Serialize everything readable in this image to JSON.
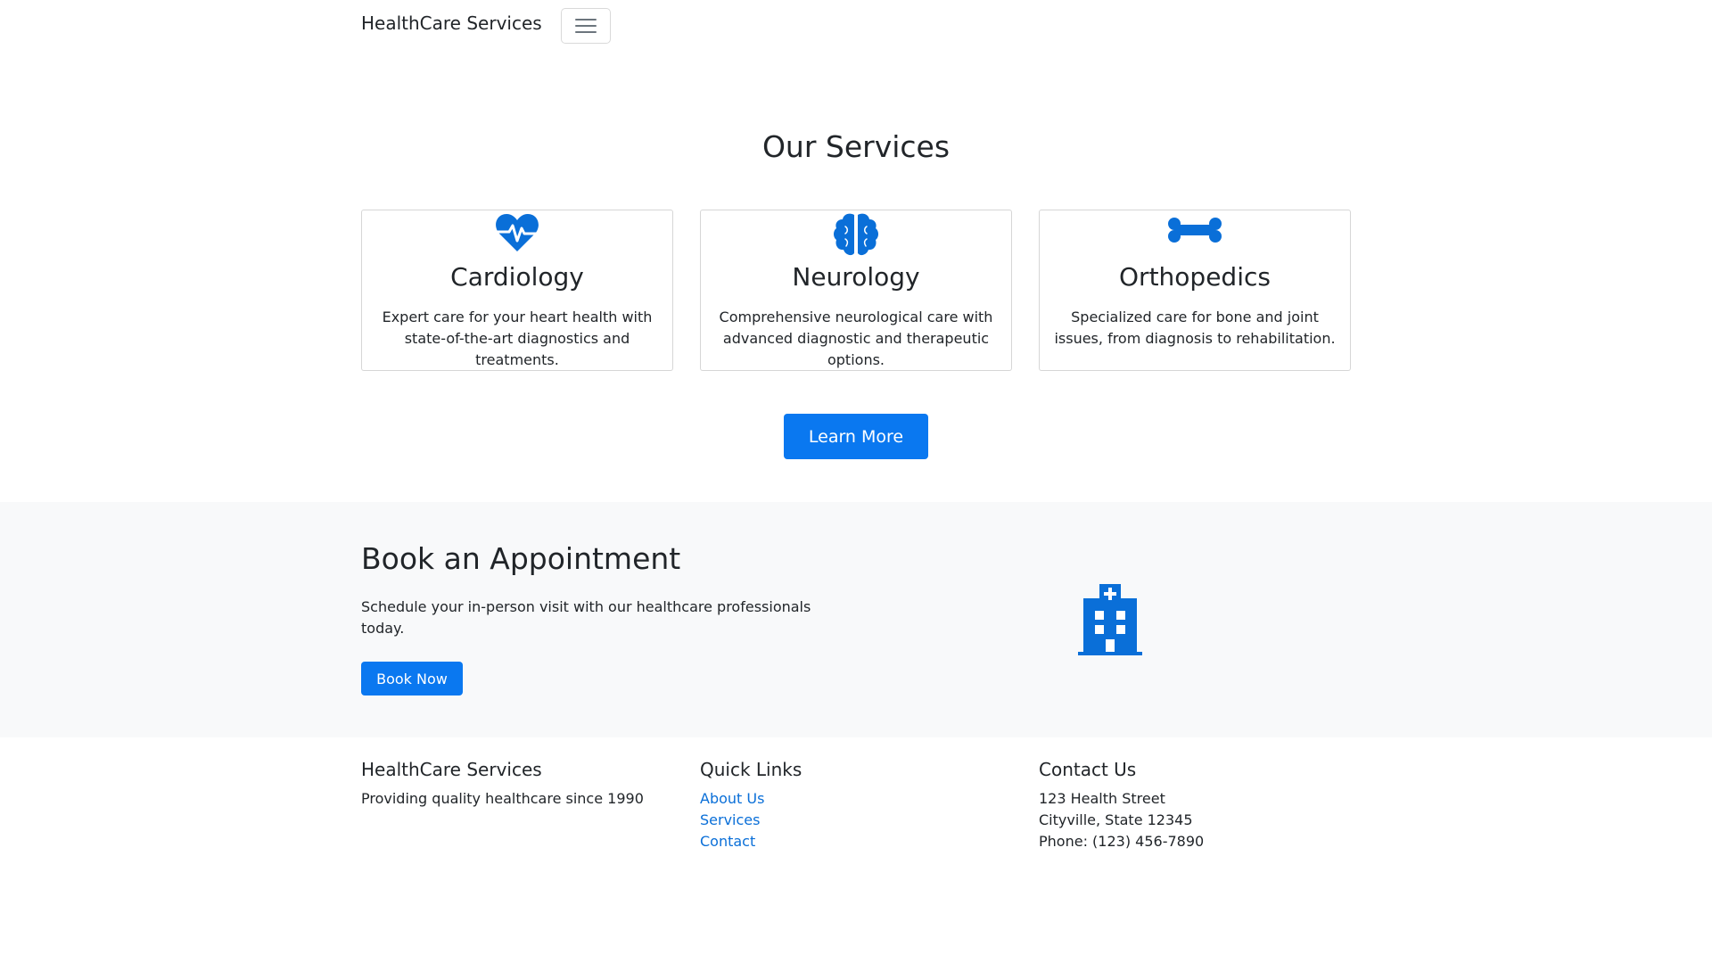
{
  "navbar": {
    "brand": "HealthCare Services",
    "toggler_icon": "hamburger-icon"
  },
  "services": {
    "title": "Our Services",
    "cards": [
      {
        "icon": "heartbeat-icon",
        "title": "Cardiology",
        "text": "Expert care for your heart health with state-of-the-art diagnostics and treatments."
      },
      {
        "icon": "brain-icon",
        "title": "Neurology",
        "text": "Comprehensive neurological care with advanced diagnostic and therapeutic options."
      },
      {
        "icon": "bone-icon",
        "title": "Orthopedics",
        "text": "Specialized care for bone and joint issues, from diagnosis to rehabilitation."
      }
    ],
    "learn_more_label": "Learn More"
  },
  "appointment": {
    "title": "Book an Appointment",
    "text": "Schedule your in-person visit with our healthcare professionals today.",
    "button_label": "Book Now",
    "icon": "hospital-icon"
  },
  "footer": {
    "about": {
      "title": "HealthCare Services",
      "text": "Providing quality healthcare since 1990"
    },
    "quick_links": {
      "title": "Quick Links",
      "links": [
        "About Us",
        "Services",
        "Contact"
      ]
    },
    "contact": {
      "title": "Contact Us",
      "lines": [
        "123 Health Street",
        "Cityville, State 12345",
        "Phone: (123) 456-7890"
      ]
    }
  },
  "colors": {
    "primary": "#0a78f0",
    "icon": "#0a6fd8",
    "section_bg": "#f8f9fa",
    "text": "#212529"
  }
}
